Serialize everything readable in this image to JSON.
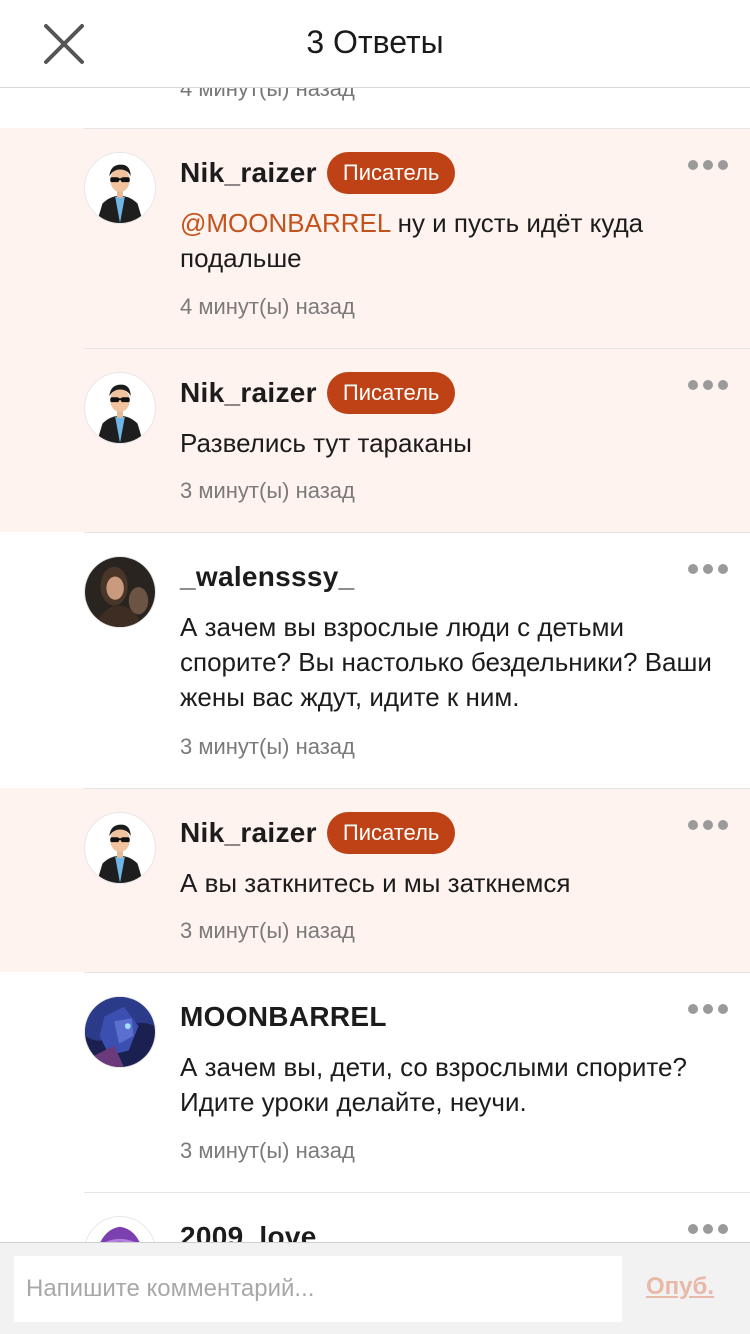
{
  "header": {
    "title": "3 Ответы"
  },
  "feed": {
    "partial_time": "4 минут(ы) назад",
    "comments": [
      {
        "username": "Nik_raizer",
        "badge": "Писатель",
        "mention": "@MOONBARREL",
        "text": " ну и пусть идёт куда подальше",
        "time": "4 минут(ы) назад",
        "avatar": "man-sunglasses-avatar"
      },
      {
        "username": "Nik_raizer",
        "badge": "Писатель",
        "text": "Развелись тут тараканы",
        "time": "3 минут(ы) назад",
        "avatar": "man-sunglasses-avatar"
      },
      {
        "username": "_walensssy_",
        "text": "А зачем вы взрослые люди с детьми спорите? Вы настолько бездельники? Ваши жены вас ждут, идите к ним.",
        "time": "3 минут(ы) назад",
        "avatar": "woman-photo-avatar"
      },
      {
        "username": "Nik_raizer",
        "badge": "Писатель",
        "text": "А вы заткнитесь и мы заткнемся",
        "time": "3 минут(ы) назад",
        "avatar": "man-sunglasses-avatar"
      },
      {
        "username": "MOONBARREL",
        "text": "А зачем вы, дети, со взрослыми спорите? Идите уроки делайте, неучи.",
        "time": "3 минут(ы) назад",
        "avatar": "anime-avatar"
      },
      {
        "username": "2009_love",
        "avatar": "purple-hood-avatar"
      }
    ]
  },
  "composer": {
    "placeholder": "Напишите комментарий...",
    "publish_label": "Опуб."
  },
  "colors": {
    "accent": "#bf4216",
    "highlight_bg": "#fff3ef",
    "mention": "#c4521b"
  }
}
